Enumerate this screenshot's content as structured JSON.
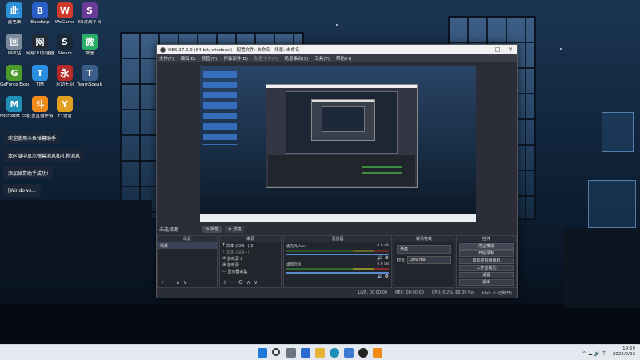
{
  "desktop": {
    "icons": [
      {
        "label": "此电脑",
        "icon": "computer-icon",
        "color": "#2d8fd8"
      },
      {
        "label": "Bandizip",
        "icon": "bandizip-icon",
        "color": "#2a5fc7"
      },
      {
        "label": "WeGame",
        "icon": "wegame-icon",
        "color": "#d03a2a"
      },
      {
        "label": "SE对战平台",
        "icon": "se-icon",
        "color": "#6b3b9a"
      },
      {
        "label": "回收站",
        "icon": "recycle-bin-icon",
        "color": "#7a8a9a"
      },
      {
        "label": "网易UU加速器",
        "icon": "uu-icon",
        "color": "#222a36"
      },
      {
        "label": "Steam",
        "icon": "steam-icon",
        "color": "#1b2838"
      },
      {
        "label": "微信",
        "icon": "wechat-icon",
        "color": "#2aae67"
      },
      {
        "label": "GeForce Experience",
        "icon": "geforce-icon",
        "color": "#4c9a2a"
      },
      {
        "label": "TIM",
        "icon": "tim-icon",
        "color": "#2a8fe0"
      },
      {
        "label": "永劫无间",
        "icon": "naraka-icon",
        "color": "#b82a2a"
      },
      {
        "label": "TeamSpeak",
        "icon": "teamspeak-icon",
        "color": "#3a5c88"
      },
      {
        "label": "Microsoft Edge",
        "icon": "edge-icon",
        "color": "#1f8fb8"
      },
      {
        "label": "斗鱼直播伴侣",
        "icon": "douyu-icon",
        "color": "#f08a1a"
      },
      {
        "label": "YY语音",
        "icon": "yy-icon",
        "color": "#e0a020"
      }
    ],
    "notices": [
      "欢迎使用斗鱼弹幕助手",
      "本区域中显示弹幕消息和礼物消息",
      "添加弹幕助手成功!",
      "[Windows..."
    ]
  },
  "obs": {
    "title": "OBS 27.2.0 (64-bit, windows) - 配置文件: 未命名 - 场景: 未命名",
    "menu": [
      "文件(F)",
      "编辑(E)",
      "视图(V)",
      "停靠部件(D)",
      "配置文件(P)",
      "场景集合(S)",
      "工具(T)",
      "帮助(H)"
    ],
    "source_status": "未选择源",
    "props_button": "属性",
    "filters_button": "滤镜",
    "scenes": {
      "header": "场景",
      "items": [
        "场景"
      ]
    },
    "sources": {
      "header": "来源",
      "items": [
        "文本 (GDI+) 2",
        "文本 (GDI+)",
        "游戏源 2",
        "游戏源",
        "显示器采集"
      ]
    },
    "mixer": {
      "header": "混音器",
      "tracks": [
        {
          "name": "麦克风/Aux",
          "db": "0.0 dB",
          "active": false
        },
        {
          "name": "桌面音频",
          "db": "0.0 dB",
          "active": true
        }
      ]
    },
    "transitions": {
      "header": "转场特效",
      "type": "渐变",
      "duration_label": "时长",
      "duration": "300 ms"
    },
    "controls": {
      "header": "控件",
      "buttons": [
        "停止推流",
        "开始录制",
        "启动虚拟摄像机",
        "工作室模式",
        "设置",
        "退出"
      ]
    },
    "status": {
      "live": "LIVE: 00:00:00",
      "rec": "REC: 00:00:00",
      "cpu": "CPU: 0.2%, 60.00 fps",
      "kbps": "kb/s: 0 (已断开)"
    }
  },
  "taskbar": {
    "time": "19:59",
    "date": "2022/2/22",
    "tray": "^ ☁ 🔊 中"
  }
}
